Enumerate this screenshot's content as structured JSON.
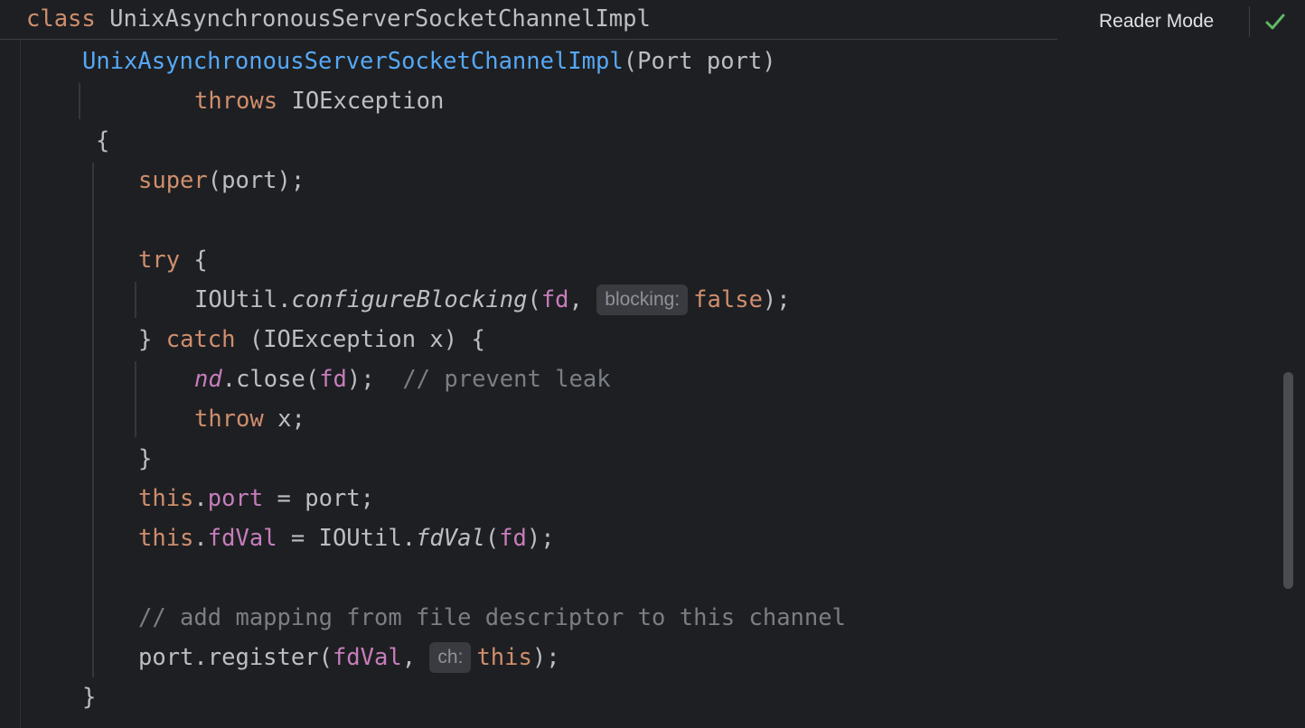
{
  "sticky_header": {
    "keyword": "class",
    "class_name": "UnixAsynchronousServerSocketChannelImpl"
  },
  "reader_mode": {
    "label": "Reader Mode",
    "status_icon": "check-icon",
    "status_color": "#5fb865"
  },
  "code": {
    "l1": {
      "fn": "UnixAsynchronousServerSocketChannelImpl",
      "rest": "(Port port)"
    },
    "l2": {
      "kw": "throws",
      "rest": " IOException"
    },
    "l3": {
      "rest": "{"
    },
    "l4": {
      "kw": "super",
      "rest": "(port);"
    },
    "l5": {
      "kw": "try",
      "rest": " {"
    },
    "l6": {
      "a": "IOUtil.",
      "m": "configureBlocking",
      "b": "(",
      "fld": "fd",
      "c": ", ",
      "hint": "blocking:",
      "kw": "false",
      "d": ");"
    },
    "l7": {
      "a": "} ",
      "kw": "catch",
      "b": " (IOException x) {"
    },
    "l8": {
      "fld": "nd",
      "a": ".close(",
      "fld2": "fd",
      "b": ");  ",
      "cmt": "// prevent leak"
    },
    "l9": {
      "kw": "throw",
      "rest": " x;"
    },
    "l10": {
      "rest": "}"
    },
    "l11": {
      "kw": "this",
      "a": ".",
      "fld": "port",
      "b": " = port;"
    },
    "l12": {
      "kw": "this",
      "a": ".",
      "fld": "fdVal",
      "b": " = IOUtil.",
      "m": "fdVal",
      "c": "(",
      "fld2": "fd",
      "d": ");"
    },
    "l13": {
      "cmt": "// add mapping from file descriptor to this channel"
    },
    "l14": {
      "a": "port.register(",
      "fld": "fdVal",
      "b": ", ",
      "hint": "ch:",
      "kw": "this",
      "c": ");"
    },
    "l15": {
      "rest": "}"
    }
  },
  "colors": {
    "background": "#1e1f22",
    "keyword": "#cf8e6d",
    "function": "#56a8f5",
    "field": "#c77dbb",
    "comment": "#7a7e85",
    "text": "#bcbec4"
  }
}
